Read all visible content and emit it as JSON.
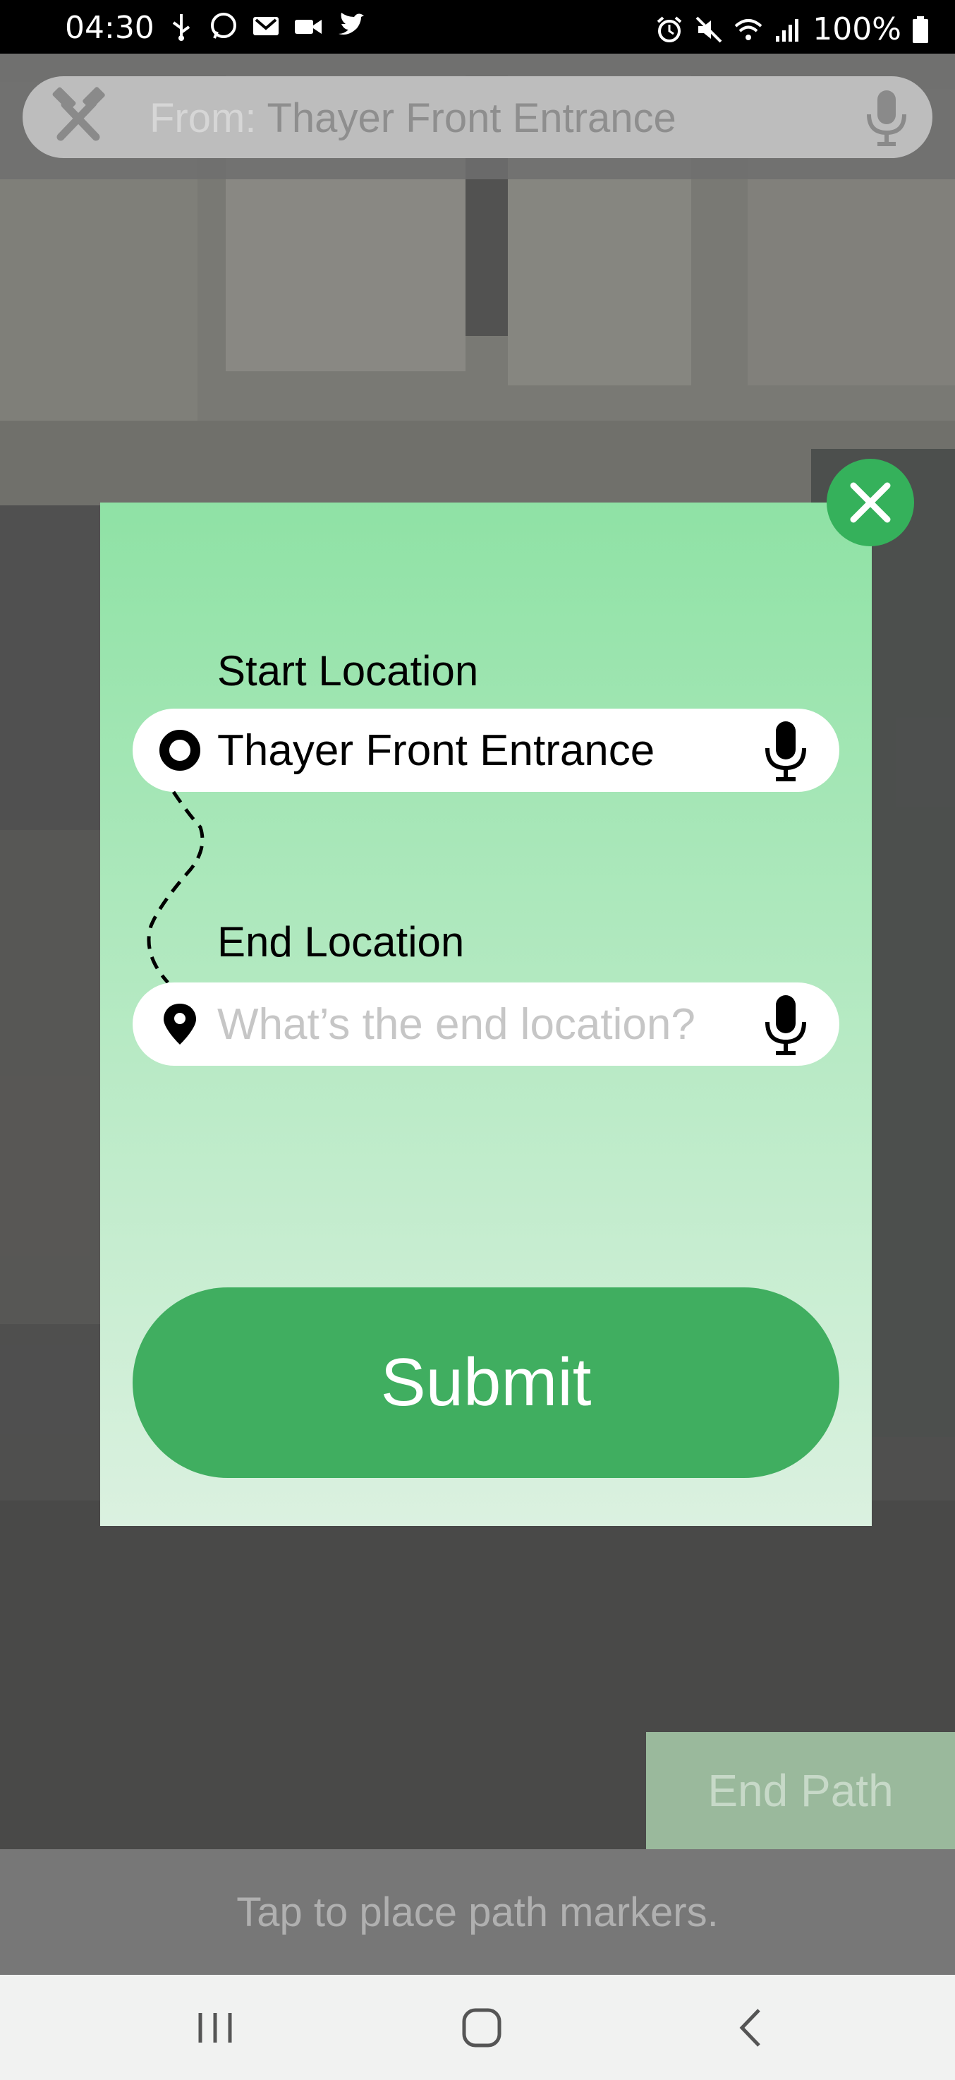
{
  "status_bar": {
    "time": "04:30",
    "battery": "100%",
    "left_icons": [
      "usb-icon",
      "whatsapp-icon",
      "gmail-icon",
      "video-icon",
      "twitter-icon"
    ],
    "right_icons": [
      "alarm-icon",
      "mute-icon",
      "wifi-icon",
      "signal-icon",
      "battery-icon"
    ]
  },
  "top_search": {
    "prefix": "From: ",
    "value": "Thayer Front Entrance"
  },
  "dialog": {
    "start_label": "Start Location",
    "start_value": "Thayer Front Entrance",
    "end_label": "End Location",
    "end_placeholder": "What’s the end location?",
    "submit_label": "Submit"
  },
  "end_path_label": "End Path",
  "hint": "Tap to place path markers.",
  "colors": {
    "accent_green": "#40ae60",
    "close_green": "#35b15b",
    "dialog_top": "#8fe2a5",
    "dialog_bottom": "#dbf1e0"
  }
}
